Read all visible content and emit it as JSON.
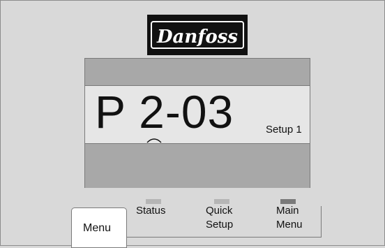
{
  "brand": {
    "name": "Danfoss"
  },
  "display": {
    "parameter": "P 2-03",
    "setup": "Setup 1"
  },
  "buttons": {
    "menu": "Menu",
    "status": "Status",
    "quick_setup": [
      "Quick",
      "Setup"
    ],
    "main_menu": [
      "Main",
      "Menu"
    ]
  },
  "indicators": {
    "status_color": "#b5b5b5",
    "quick_setup_color": "#b5b5b5",
    "main_menu_color": "#7a7a7a"
  }
}
